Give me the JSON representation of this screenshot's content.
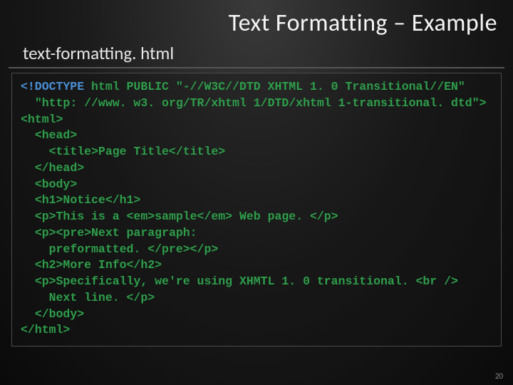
{
  "title": "Text Formatting – Example",
  "filename": "text-formatting. html",
  "code_lines": [
    {
      "indent": 0,
      "spans": [
        {
          "t": "<!DOCTYPE",
          "kw": true
        },
        {
          "t": " html PUBLIC \"-//W3C//DTD XHTML 1. 0 Transitional//EN\""
        }
      ]
    },
    {
      "indent": 1,
      "spans": [
        {
          "t": "\"http: //www. w3. org/TR/xhtml 1/DTD/xhtml 1-transitional. dtd\">"
        }
      ]
    },
    {
      "indent": 0,
      "spans": [
        {
          "t": "<html>"
        }
      ]
    },
    {
      "indent": 1,
      "spans": [
        {
          "t": "<head>"
        }
      ]
    },
    {
      "indent": 2,
      "spans": [
        {
          "t": "<title>Page Title</title>"
        }
      ]
    },
    {
      "indent": 1,
      "spans": [
        {
          "t": "</head>"
        }
      ]
    },
    {
      "indent": 1,
      "spans": [
        {
          "t": "<body>"
        }
      ]
    },
    {
      "indent": 1,
      "spans": [
        {
          "t": "<h1>Notice</h1>"
        }
      ]
    },
    {
      "indent": 1,
      "spans": [
        {
          "t": "<p>This is a <em>sample</em> Web page. </p>"
        }
      ]
    },
    {
      "indent": 1,
      "spans": [
        {
          "t": "<p><pre>Next paragraph:"
        }
      ]
    },
    {
      "indent": 2,
      "spans": [
        {
          "t": "preformatted. </pre></p>"
        }
      ]
    },
    {
      "indent": 1,
      "spans": [
        {
          "t": "<h2>More Info</h2>"
        }
      ]
    },
    {
      "indent": 1,
      "spans": [
        {
          "t": "<p>Specifically, we're using XHMTL 1. 0 transitional. <br />"
        }
      ]
    },
    {
      "indent": 2,
      "spans": [
        {
          "t": "Next line. </p>"
        }
      ]
    },
    {
      "indent": 1,
      "spans": [
        {
          "t": "</body>"
        }
      ]
    },
    {
      "indent": 0,
      "spans": [
        {
          "t": "</html>"
        }
      ]
    }
  ],
  "page_number": "20"
}
